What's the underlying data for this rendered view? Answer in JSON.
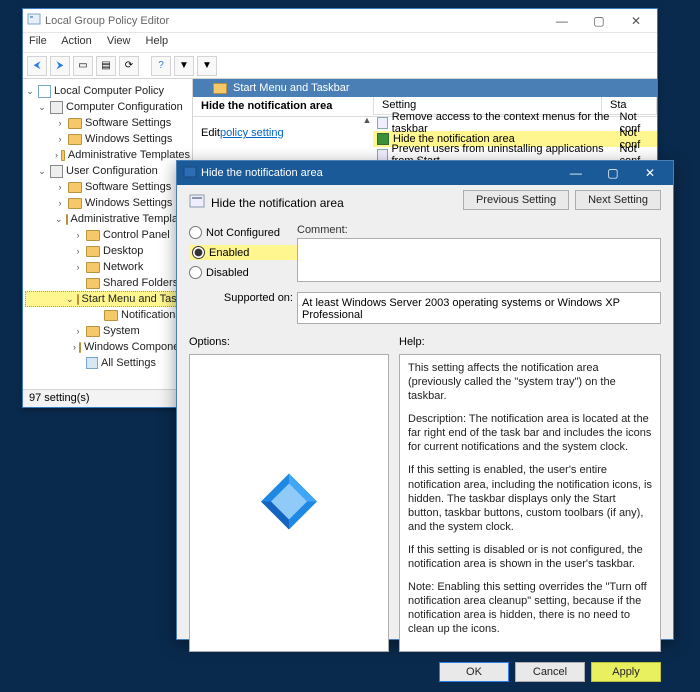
{
  "gpedit": {
    "title": "Local Group Policy Editor",
    "menu": [
      "File",
      "Action",
      "View",
      "Help"
    ],
    "toolbar_icons": [
      "back",
      "forward",
      "up",
      "props",
      "refresh",
      "export",
      "help",
      "filter",
      "filter2"
    ],
    "tree": {
      "root": "Local Computer Policy",
      "computer": "Computer Configuration",
      "sw1": "Software Settings",
      "win1": "Windows Settings",
      "adm1": "Administrative Templates",
      "user": "User Configuration",
      "sw2": "Software Settings",
      "win2": "Windows Settings",
      "adm2": "Administrative Templates",
      "cpanel": "Control Panel",
      "desktop": "Desktop",
      "network": "Network",
      "shared": "Shared Folders",
      "start": "Start Menu and Taskbar",
      "notif": "Notifications",
      "system": "System",
      "wincomp": "Windows Components",
      "all": "All Settings"
    },
    "right": {
      "header": "Start Menu and Taskbar",
      "selected_title": "Hide the notification area",
      "edit_prefix": "Edit ",
      "edit_link": "policy setting",
      "col_setting": "Setting",
      "col_state": "Sta",
      "rows": [
        {
          "label": "Remove access to the context menus for the taskbar",
          "state": "Not conf"
        },
        {
          "label": "Hide the notification area",
          "state": "Not conf"
        },
        {
          "label": "Prevent users from uninstalling applications from Start",
          "state": "Not conf"
        }
      ]
    },
    "status": "97 setting(s)"
  },
  "modal": {
    "title": "Hide the notification area",
    "setting_name": "Hide the notification area",
    "prev": "Previous Setting",
    "next": "Next Setting",
    "radio_notconf": "Not Configured",
    "radio_enabled": "Enabled",
    "radio_disabled": "Disabled",
    "comment_lbl": "Comment:",
    "supported_lbl": "Supported on:",
    "supported_txt": "At least Windows Server 2003 operating systems or Windows XP Professional",
    "options_lbl": "Options:",
    "help_lbl": "Help:",
    "help": {
      "p1": "This setting affects the notification area (previously called the \"system tray\") on the taskbar.",
      "p2": "Description: The notification area is located at the far right end of the task bar and includes the icons for current notifications and the system clock.",
      "p3": "If this setting is enabled, the user's entire notification area, including the notification icons, is hidden. The taskbar displays only the Start button, taskbar buttons, custom toolbars (if any), and the system clock.",
      "p4": "If this setting is disabled or is not configured, the notification area is shown in the user's taskbar.",
      "p5": "Note: Enabling this setting overrides the \"Turn off notification area cleanup\" setting, because if the notification area is hidden, there is no need to clean up the icons."
    },
    "ok": "OK",
    "cancel": "Cancel",
    "apply": "Apply"
  }
}
